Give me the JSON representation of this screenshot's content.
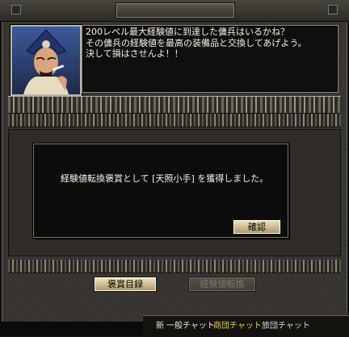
{
  "npc": {
    "dialogue": "200レベル最大経験値に到達した傭兵はいるかね？\nその傭兵の経験値を最高の装備品と交換してあげよう。\n決して損はさせんよ！！"
  },
  "reward_dialog": {
    "message": "経験値転換褒賞として [天照小手] を獲得しました。",
    "confirm_label": "確認"
  },
  "buttons": {
    "reward_list_label": "褒賞目録",
    "exp_convert_label": "経験値転換"
  },
  "chat": {
    "new_label": "新",
    "normal_chat_label": "一般チャット",
    "brigade_chat_label": "商団チャット",
    "brigade_chat_label_2": "旅団チャット"
  },
  "colors": {
    "chat_normal": "#e9e6dc",
    "chat_trade": "#e8d04a",
    "chat_brigade": "#d9d6cc"
  }
}
